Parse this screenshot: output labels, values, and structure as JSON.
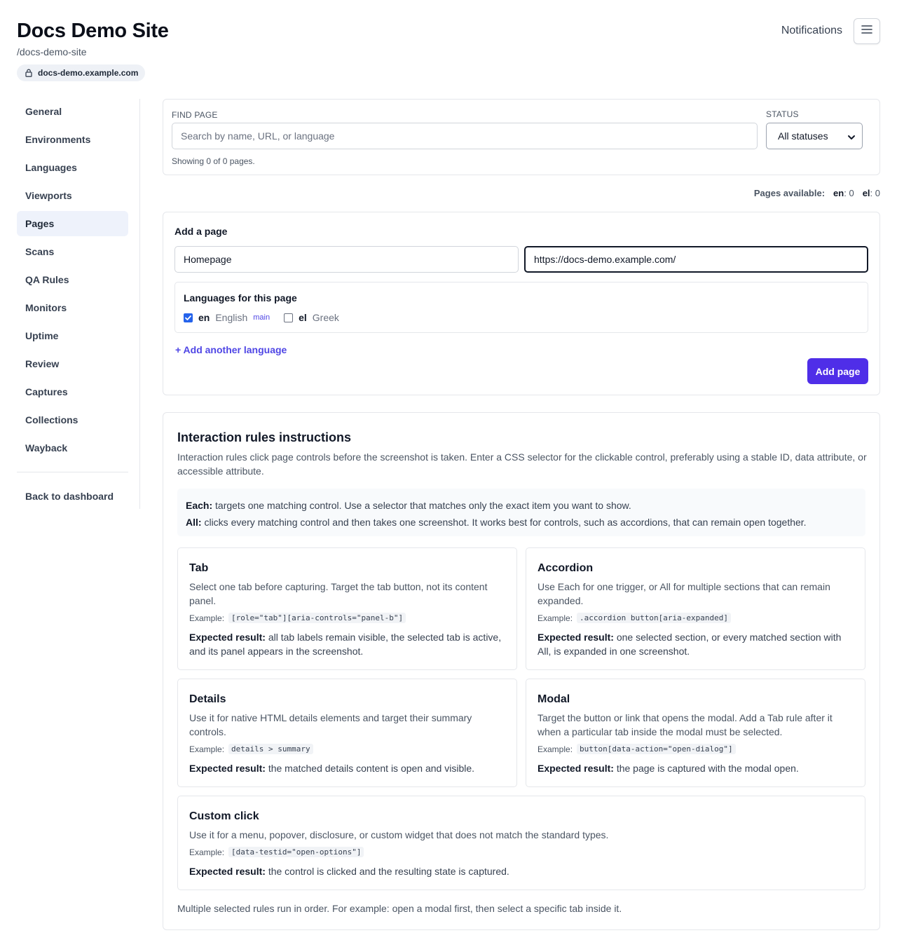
{
  "header": {
    "title": "Docs Demo Site",
    "slug": "/docs-demo-site",
    "domain": "docs-demo.example.com",
    "notifications_label": "Notifications",
    "menu_icon": "hamburger-icon"
  },
  "sidebar": {
    "items": [
      {
        "label": "General"
      },
      {
        "label": "Environments"
      },
      {
        "label": "Languages"
      },
      {
        "label": "Viewports"
      },
      {
        "label": "Pages",
        "active": true
      },
      {
        "label": "Scans"
      },
      {
        "label": "QA Rules"
      },
      {
        "label": "Monitors"
      },
      {
        "label": "Uptime"
      },
      {
        "label": "Review"
      },
      {
        "label": "Captures"
      },
      {
        "label": "Collections"
      },
      {
        "label": "Wayback"
      }
    ],
    "back_label": "Back to dashboard"
  },
  "filter": {
    "find_label": "FIND PAGE",
    "search_placeholder": "Search by name, URL, or language",
    "status_label": "STATUS",
    "status_value": "All statuses",
    "showing_text": "Showing 0 of 0 pages."
  },
  "availability": {
    "label": "Pages available:",
    "en_code": "en",
    "en_count": ": 0",
    "el_code": "el",
    "el_count": ": 0"
  },
  "add_page": {
    "title": "Add a page",
    "name_value": "Homepage",
    "url_value": "https://docs-demo.example.com/",
    "languages_title": "Languages for this page",
    "languages": [
      {
        "code": "en",
        "name": "English",
        "tag": "main",
        "checked": true
      },
      {
        "code": "el",
        "name": "Greek",
        "tag": "",
        "checked": false
      }
    ],
    "add_language_link": "+ Add another language",
    "submit_label": "Add page",
    "accent_color": "#4f2ee8"
  },
  "rules": {
    "title": "Interaction rules instructions",
    "description": "Interaction rules click page controls before the screenshot is taken. Enter a CSS selector for the clickable control, preferably using a stable ID, data attribute, or accessible attribute.",
    "modes": [
      {
        "name": "Each:",
        "text": "targets one matching control. Use a selector that matches only the exact item you want to show."
      },
      {
        "name": "All:",
        "text": "clicks every matching control and then takes one screenshot. It works best for controls, such as accordions, that can remain open together."
      }
    ],
    "example_label": "Example:",
    "expected_label": "Expected result:",
    "types": [
      {
        "title": "Tab",
        "description": "Select one tab before capturing. Target the tab button, not its content panel.",
        "example": "[role=\"tab\"][aria-controls=\"panel-b\"]",
        "expected": "all tab labels remain visible, the selected tab is active, and its panel appears in the screenshot."
      },
      {
        "title": "Accordion",
        "description": "Use Each for one trigger, or All for multiple sections that can remain expanded.",
        "example": ".accordion button[aria-expanded]",
        "expected": "one selected section, or every matched section with All, is expanded in one screenshot."
      },
      {
        "title": "Details",
        "description": "Use it for native HTML details elements and target their summary controls.",
        "example": "details > summary",
        "expected": "the matched details content is open and visible."
      },
      {
        "title": "Modal",
        "description": "Target the button or link that opens the modal. Add a Tab rule after it when a particular tab inside the modal must be selected.",
        "example": "button[data-action=\"open-dialog\"]",
        "expected": "the page is captured with the modal open."
      },
      {
        "title": "Custom click",
        "description": "Use it for a menu, popover, disclosure, or custom widget that does not match the standard types.",
        "example": "[data-testid=\"open-options\"]",
        "expected": "the control is clicked and the resulting state is captured."
      }
    ],
    "footnote": "Multiple selected rules run in order. For example: open a modal first, then select a specific tab inside it."
  }
}
